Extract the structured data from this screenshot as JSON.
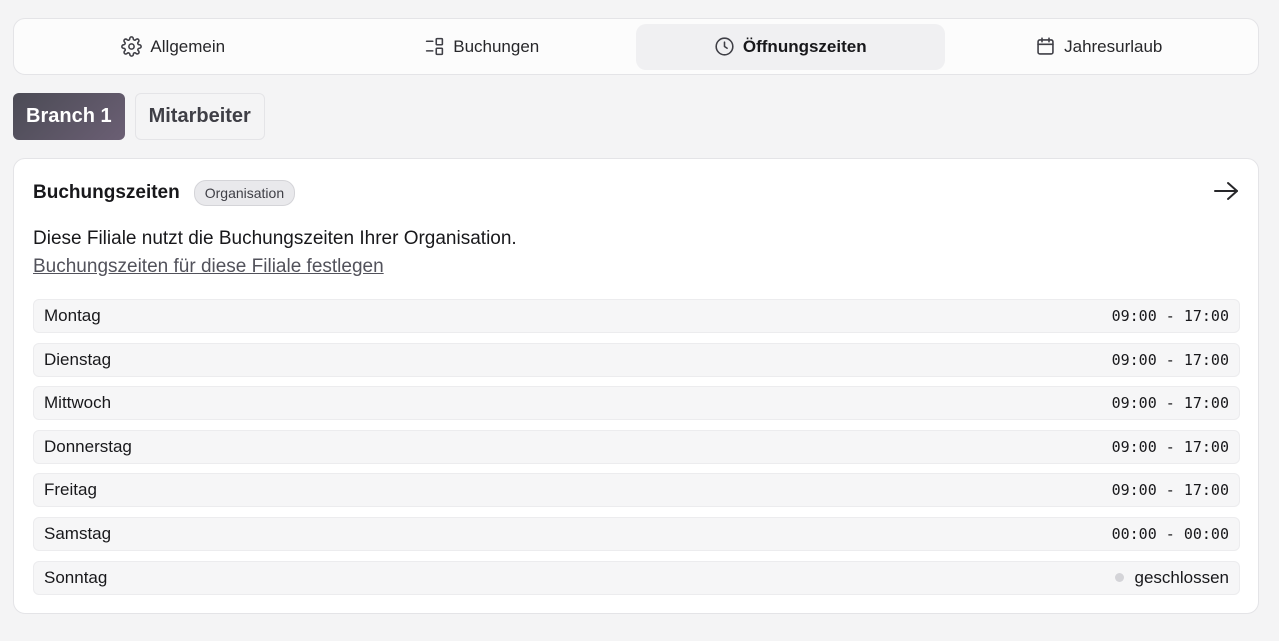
{
  "tabs": [
    {
      "label": "Allgemein",
      "icon": "gear-icon",
      "active": false
    },
    {
      "label": "Buchungen",
      "icon": "layout-list-icon",
      "active": false
    },
    {
      "label": "Öffnungszeiten",
      "icon": "clock-icon",
      "active": true
    },
    {
      "label": "Jahresurlaub",
      "icon": "calendar-icon",
      "active": false
    }
  ],
  "branches": [
    {
      "label": "Branch 1",
      "active": true
    },
    {
      "label": "Mitarbeiter",
      "active": false
    }
  ],
  "card": {
    "title": "Buchungszeiten",
    "badge": "Organisation",
    "description": "Diese Filiale nutzt die Buchungszeiten Ihrer Organisation.",
    "link": "Buchungszeiten für diese Filiale festlegen",
    "arrow_icon": "arrow-right-icon"
  },
  "schedule": [
    {
      "day": "Montag",
      "time": "09:00 - 17:00"
    },
    {
      "day": "Dienstag",
      "time": "09:00 - 17:00"
    },
    {
      "day": "Mittwoch",
      "time": "09:00 - 17:00"
    },
    {
      "day": "Donnerstag",
      "time": "09:00 - 17:00"
    },
    {
      "day": "Freitag",
      "time": "09:00 - 17:00"
    },
    {
      "day": "Samstag",
      "time": "00:00 - 00:00"
    },
    {
      "day": "Sonntag",
      "closed": "geschlossen"
    }
  ],
  "colors": {
    "accent_chip": "#4b4b55",
    "closed_dot": "#d4d4d8"
  }
}
